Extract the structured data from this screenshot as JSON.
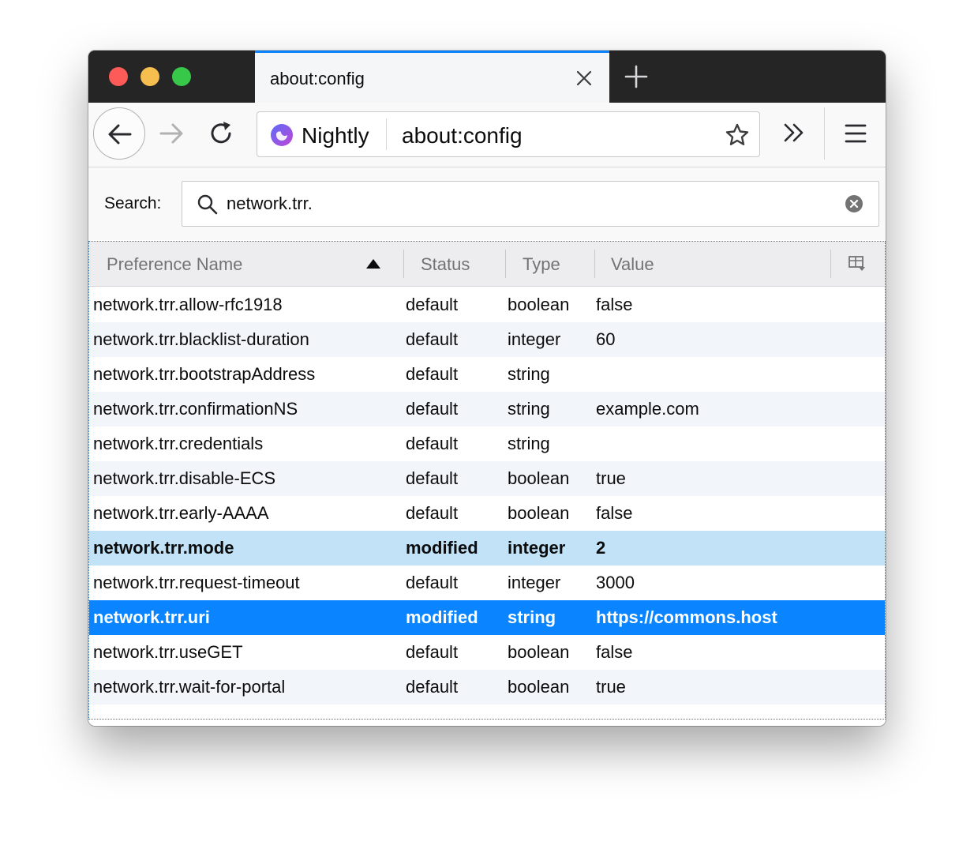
{
  "tab": {
    "title": "about:config"
  },
  "urlbar": {
    "identity_label": "Nightly",
    "url": "about:config"
  },
  "search": {
    "label": "Search:",
    "value": "network.trr."
  },
  "columns": {
    "name": "Preference Name",
    "status": "Status",
    "type": "Type",
    "value": "Value"
  },
  "rows": [
    {
      "name": "network.trr.allow-rfc1918",
      "status": "default",
      "type": "boolean",
      "value": "false"
    },
    {
      "name": "network.trr.blacklist-duration",
      "status": "default",
      "type": "integer",
      "value": "60"
    },
    {
      "name": "network.trr.bootstrapAddress",
      "status": "default",
      "type": "string",
      "value": ""
    },
    {
      "name": "network.trr.confirmationNS",
      "status": "default",
      "type": "string",
      "value": "example.com"
    },
    {
      "name": "network.trr.credentials",
      "status": "default",
      "type": "string",
      "value": ""
    },
    {
      "name": "network.trr.disable-ECS",
      "status": "default",
      "type": "boolean",
      "value": "true"
    },
    {
      "name": "network.trr.early-AAAA",
      "status": "default",
      "type": "boolean",
      "value": "false"
    },
    {
      "name": "network.trr.mode",
      "status": "modified",
      "type": "integer",
      "value": "2"
    },
    {
      "name": "network.trr.request-timeout",
      "status": "default",
      "type": "integer",
      "value": "3000"
    },
    {
      "name": "network.trr.uri",
      "status": "modified",
      "type": "string",
      "value": "https://commons.host"
    },
    {
      "name": "network.trr.useGET",
      "status": "default",
      "type": "boolean",
      "value": "false"
    },
    {
      "name": "network.trr.wait-for-portal",
      "status": "default",
      "type": "boolean",
      "value": "true"
    }
  ],
  "state": {
    "selected_row": "network.trr.uri",
    "highlighted_row": "network.trr.mode",
    "sort_column": "name",
    "sort_direction": "ascending"
  },
  "colors": {
    "accent": "#0a84ff",
    "tabstrip": "#252526",
    "highlight": "#c1e2f7",
    "alt_row": "#f2f5fa"
  },
  "icons": {
    "tab_close": "close-icon",
    "new_tab": "plus-icon",
    "back": "back-arrow-icon",
    "forward": "forward-arrow-icon",
    "reload": "reload-icon",
    "identity": "nightly-logo-icon",
    "bookmark": "star-icon",
    "overflow": "chevron-double-right-icon",
    "menu": "hamburger-menu-icon",
    "search": "search-icon",
    "clear": "clear-circle-icon",
    "sort": "sort-ascending-icon",
    "column_picker": "column-picker-icon"
  }
}
